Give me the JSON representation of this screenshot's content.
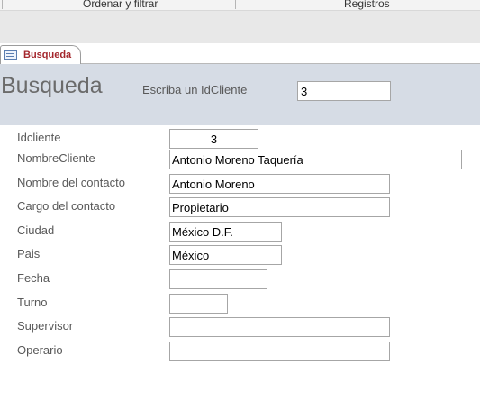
{
  "ribbon": {
    "group_left": "Ordenar y filtrar",
    "group_right": "Registros"
  },
  "tab": {
    "label": "Busqueda"
  },
  "header": {
    "title": "Busqueda",
    "search_label": "Escriba un IdCliente",
    "search_value": "3"
  },
  "fields": {
    "idcliente": {
      "label": "Idcliente",
      "value": "3"
    },
    "nombrecliente": {
      "label": "NombreCliente",
      "value": "Antonio Moreno Taquería"
    },
    "nombre_contacto": {
      "label": "Nombre del contacto",
      "value": "Antonio Moreno"
    },
    "cargo_contacto": {
      "label": "Cargo del contacto",
      "value": "Propietario"
    },
    "ciudad": {
      "label": "Ciudad",
      "value": "México D.F."
    },
    "pais": {
      "label": "Pais",
      "value": "México"
    },
    "fecha": {
      "label": "Fecha",
      "value": ""
    },
    "turno": {
      "label": "Turno",
      "value": ""
    },
    "supervisor": {
      "label": "Supervisor",
      "value": ""
    },
    "operario": {
      "label": "Operario",
      "value": ""
    }
  }
}
